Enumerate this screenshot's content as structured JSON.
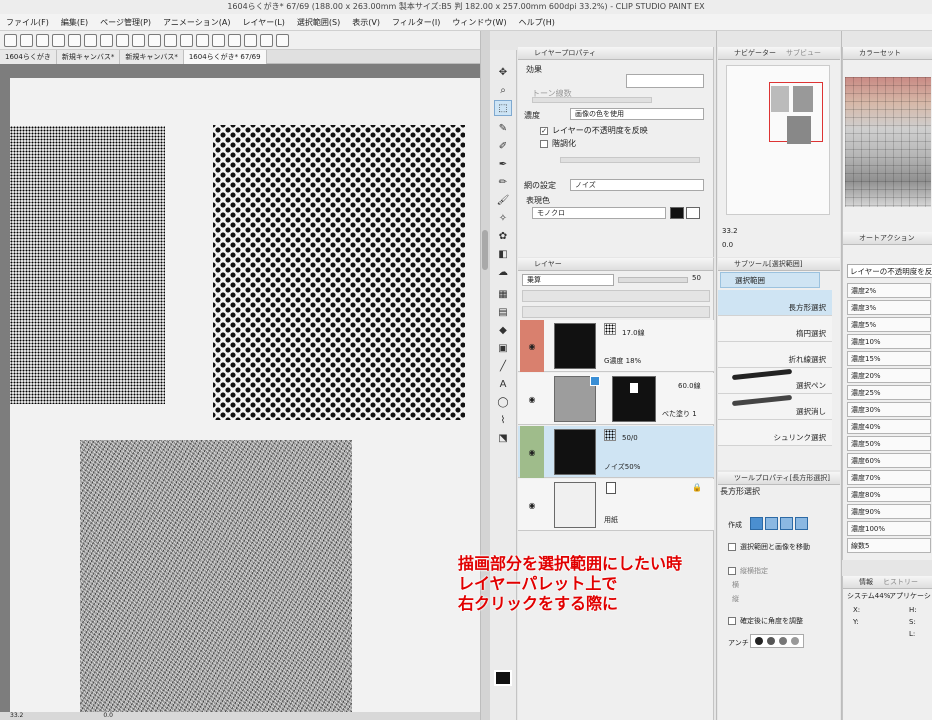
{
  "titlebar": {
    "text": "1604らくがき* 67/69 (188.00 x 263.00mm 製本サイズ:B5 判 182.00 x 257.00mm 600dpi 33.2%) - CLIP STUDIO PAINT EX"
  },
  "menu": {
    "items": [
      "ファイル(F)",
      "編集(E)",
      "ページ管理(P)",
      "アニメーション(A)",
      "レイヤー(L)",
      "選択範囲(S)",
      "表示(V)",
      "フィルター(I)",
      "ウィンドウ(W)",
      "ヘルプ(H)"
    ]
  },
  "doc_tabs": [
    "1604らくがき",
    "新規キャンバス*",
    "新規キャンバス*",
    "1604らくがき* 67/69"
  ],
  "status": {
    "zoom": "33.2",
    "angle": "0.0"
  },
  "layer_property": {
    "tab": "レイヤープロパティ",
    "effect_label": "効果",
    "tone_label": "トーン線数",
    "density_label": "濃度",
    "density_value": "画像の色を使用",
    "opacity_reflect": "レイヤーの不透明度を反映",
    "posterize": "階調化",
    "frequency_label": "網の設定",
    "frequency_value": "ノイズ",
    "expression_color_label": "表現色",
    "expression_color_value": "モノクロ"
  },
  "layer_panel": {
    "tab": "レイヤー",
    "blend_mode": "乗算",
    "opacity": "50",
    "layers": [
      {
        "line1": "17.0線",
        "line2": "G濃度 18%"
      },
      {
        "line1": "60.0線",
        "line2": "べた塗り 1"
      },
      {
        "line1": "50/0",
        "line2": "ノイズ50%"
      },
      {
        "line1": "",
        "line2": "用紙"
      }
    ]
  },
  "navigator": {
    "tabs": [
      "ナビゲーター",
      "サブビュー"
    ],
    "zoom": "33.2",
    "angle": "0.0"
  },
  "color_set": {
    "tab": "カラーセット"
  },
  "sub_tool": {
    "tab": "サブツール[選択範囲]",
    "group": "選択範囲",
    "items": [
      "長方形選択",
      "楕円選択",
      "折れ線選択",
      "選択ペン",
      "選択消し",
      "シュリンク選択"
    ]
  },
  "tool_property": {
    "tab": "ツールプロパティ[長方形選択]",
    "name": "長方形選択",
    "mode_label": "作成",
    "select_image": "選択範囲と画像を移動",
    "aspect": "縦横指定",
    "width": "横",
    "height": "縦",
    "angle_adjust": "確定後に角度を調整",
    "antialias": "アンチ"
  },
  "auto_action": {
    "tab": "オートアクション",
    "header": "レイヤーの不透明度を反映",
    "items": [
      "濃度2%",
      "濃度3%",
      "濃度5%",
      "濃度10%",
      "濃度15%",
      "濃度20%",
      "濃度25%",
      "濃度30%",
      "濃度40%",
      "濃度50%",
      "濃度60%",
      "濃度70%",
      "濃度80%",
      "濃度90%",
      "濃度100%",
      "線数5"
    ]
  },
  "info_panel": {
    "tabs": [
      "情報",
      "ヒストリー"
    ],
    "system": "システム44%",
    "application": "アプリケーション",
    "x": "X:",
    "y": "Y:",
    "h": "H:",
    "s": "S:",
    "l": "L:"
  },
  "annotation": {
    "lines": [
      "描画部分を選択範囲にしたい時",
      "レイヤーパレット上で",
      "右クリックをする際に"
    ]
  },
  "colors": {
    "accent": "#e10000",
    "layer_mask_red": "#d9806e",
    "layer_mask_green": "#9fbc8b",
    "selection_blue": "#cfe4f3"
  }
}
